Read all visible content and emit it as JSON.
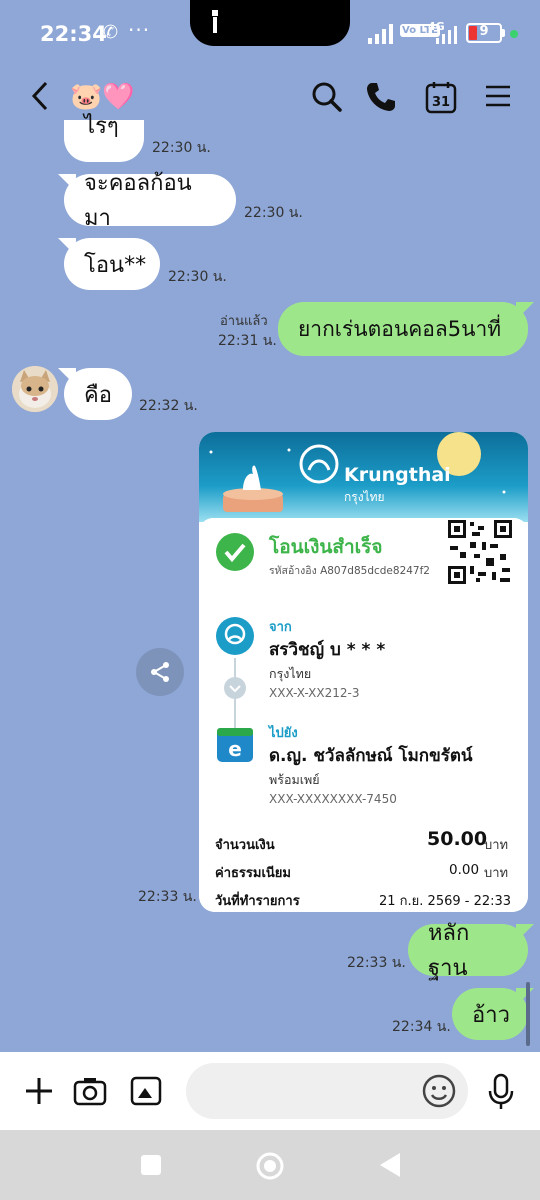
{
  "status_bar": {
    "time": "22:34",
    "extra_icons": "···",
    "volte": "Vo LTE",
    "network": "4G",
    "battery": "9"
  },
  "header": {
    "title": "🐷🩷",
    "calendar_day": "31"
  },
  "messages": [
    {
      "side": "in",
      "text": "ไรๆ",
      "time": "22:30 น."
    },
    {
      "side": "in",
      "text": "จะคอลก้อนมา",
      "time": "22:30 น."
    },
    {
      "side": "in",
      "text": "โอน**",
      "time": "22:30 น."
    },
    {
      "side": "out",
      "text": "ยากเร่นตอนคอล5นาที่",
      "time": "22:31 น.",
      "read": "อ่านแล้ว"
    },
    {
      "side": "in",
      "text": "คือ",
      "time": "22:32 น."
    },
    {
      "side": "in",
      "type": "slip",
      "time": "22:33 น."
    },
    {
      "side": "out",
      "text": "หลักฐาน",
      "time": "22:33 น."
    },
    {
      "side": "out",
      "text": "อ้าว",
      "time": "22:34 น."
    }
  ],
  "slip": {
    "bank_name": "Krungthai",
    "bank_name_th": "กรุงไทย",
    "status": "โอนเงินสำเร็จ",
    "reference": "รหัสอ้างอิง A807d85dcde8247f2",
    "from_label": "จาก",
    "from_name": "สรวิชญ์ บ * * *",
    "from_bank": "กรุงไทย",
    "from_account": "XXX-X-XX212-3",
    "to_label": "ไปยัง",
    "to_name": "ด.ญ. ชวัลลักษณ์ โมกขรัตน์",
    "to_bank": "พร้อมเพย์",
    "to_account": "XXX-XXXXXXXX-7450",
    "amount_label": "จำนวนเงิน",
    "amount": "50.00",
    "currency": "บาท",
    "fee_label": "ค่าธรรมเนียม",
    "fee": "0.00",
    "fee_currency": "บาท",
    "date_label": "วันที่ทำรายการ",
    "date": "21 ก.ย. 2569 - 22:33"
  },
  "colors": {
    "background": "#8FA7D6",
    "outgoing_bubble": "#9EE68A",
    "incoming_bubble": "#FFFFFF",
    "krungthai_blue": "#1C9DC8",
    "success_green": "#3DB54A"
  }
}
